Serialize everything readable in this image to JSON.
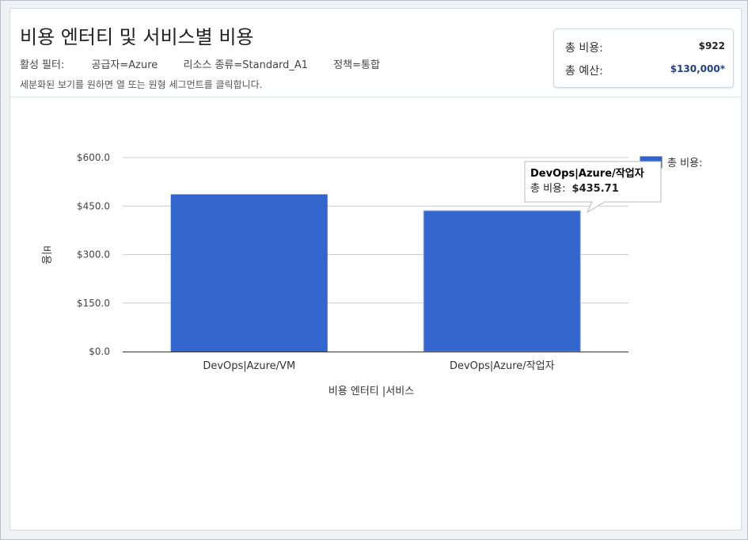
{
  "header": {
    "title": "비용 엔터티 및 서비스별 비용",
    "filters_label": "활성 필터:",
    "filters": [
      "공급자=Azure",
      "리소스 종류=Standard_A1",
      "정책=통합"
    ],
    "hint": "세분화된 보기를 원하면 열 또는 원형 세그먼트를 클릭합니다."
  },
  "summary": {
    "total_cost_label": "총 비용:",
    "total_cost_value": "$922",
    "total_budget_label": "총 예산:",
    "total_budget_value": "$130,000*"
  },
  "chart_data": {
    "type": "bar",
    "categories": [
      "DevOps|Azure/VM",
      "DevOps|Azure/작업자"
    ],
    "series": [
      {
        "name": "총 비용:",
        "values": [
          486.29,
          435.71
        ],
        "color": "#3366cc"
      }
    ],
    "ylim": [
      0,
      600
    ],
    "yticks": [
      0,
      150,
      300,
      450,
      600
    ],
    "ytick_labels": [
      "$0.0",
      "$150.0",
      "$300.0",
      "$450.0",
      "$600.0"
    ],
    "xlabel": "비용 엔터티 |서비스",
    "ylabel": "비용",
    "grid": true,
    "legend_position": "right",
    "tooltip": {
      "title": "DevOps|Azure/작업자",
      "label": "총 비용:",
      "value": "$435.71"
    }
  }
}
